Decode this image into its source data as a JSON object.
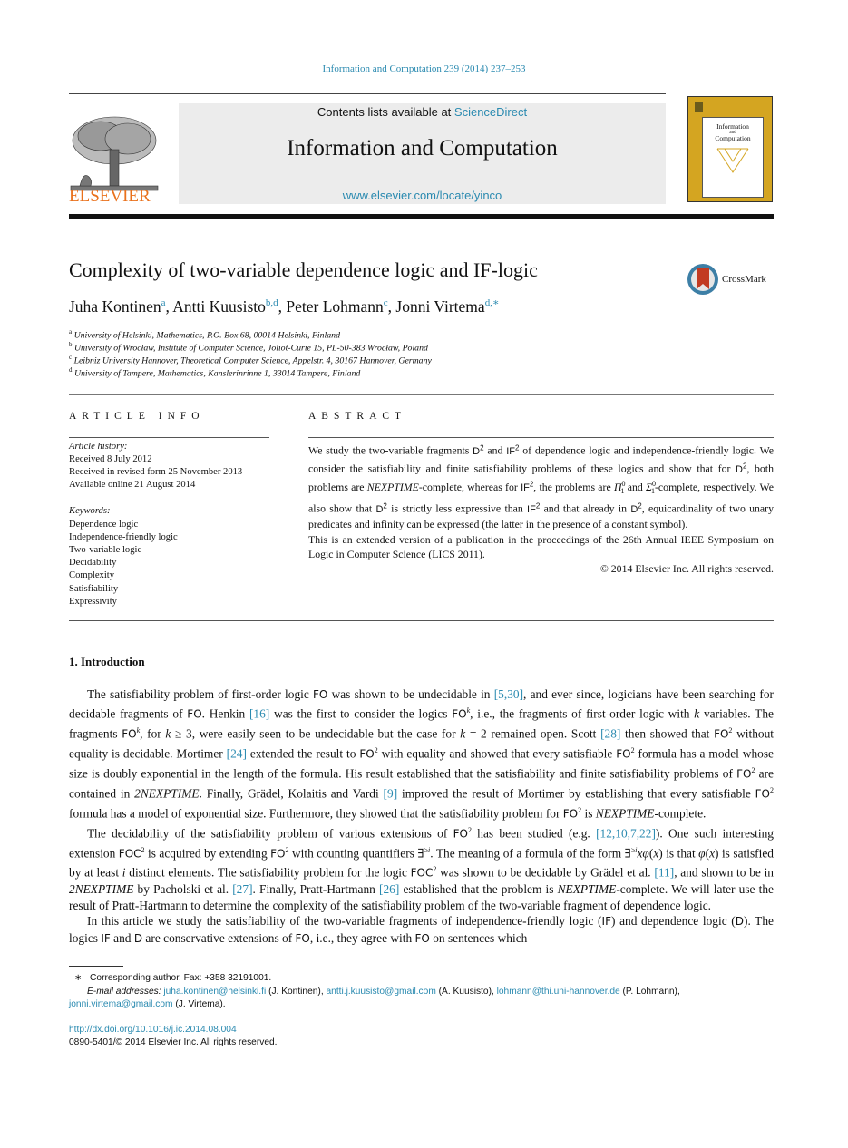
{
  "header": {
    "journal_ref": "Information and Computation 239 (2014) 237–253",
    "contents_prefix": "Contents lists available at ",
    "contents_link": "ScienceDirect",
    "journal_title": "Information and Computation",
    "journal_url": "www.elsevier.com/locate/yinco",
    "publisher": "ELSEVIER",
    "cover_title_1": "Information",
    "cover_title_2": "and",
    "cover_title_3": "Computation",
    "colors": {
      "link": "#2a8ab0",
      "elsevier_orange": "#e9711c",
      "cover_gold": "#d4a521"
    }
  },
  "article": {
    "title": "Complexity of two-variable dependence logic and IF-logic",
    "crossmark_label": "CrossMark",
    "authors": [
      {
        "name": "Juha Kontinen",
        "marks": "a"
      },
      {
        "name": "Antti Kuusisto",
        "marks": "b,d"
      },
      {
        "name": "Peter Lohmann",
        "marks": "c"
      },
      {
        "name": "Jonni Virtema",
        "marks": "d,∗"
      }
    ],
    "affiliations": [
      {
        "mark": "a",
        "text": "University of Helsinki, Mathematics, P.O. Box 68, 00014 Helsinki, Finland"
      },
      {
        "mark": "b",
        "text": "University of Wrocław, Institute of Computer Science, Joliot-Curie 15, PL-50-383 Wrocław, Poland"
      },
      {
        "mark": "c",
        "text": "Leibniz University Hannover, Theoretical Computer Science, Appelstr. 4, 30167 Hannover, Germany"
      },
      {
        "mark": "d",
        "text": "University of Tampere, Mathematics, Kanslerinrinne 1, 33014 Tampere, Finland"
      }
    ]
  },
  "article_info": {
    "heading": "ARTICLE INFO",
    "history_label": "Article history:",
    "history": [
      "Received 8 July 2012",
      "Received in revised form 25 November 2013",
      "Available online 21 August 2014"
    ],
    "keywords_label": "Keywords:",
    "keywords": [
      "Dependence logic",
      "Independence-friendly logic",
      "Two-variable logic",
      "Decidability",
      "Complexity",
      "Satisfiability",
      "Expressivity"
    ]
  },
  "abstract": {
    "heading": "ABSTRACT",
    "p1": {
      "a": "We study the two-variable fragments ",
      "b": " and ",
      "c": " of dependence logic and independence-friendly logic. We consider the satisfiability and finite satisfiability problems of these logics and show that for ",
      "d": ", both problems are ",
      "e": "NEXPTIME",
      "f": "-complete, whereas for ",
      "g": ", the problems are ",
      "h": " and ",
      "i": "-complete, respectively. We also show that ",
      "j": " is strictly less expressive than ",
      "k": " and that already in ",
      "l": ", equicardinality of two unary predicates and infinity can be expressed (the latter in the presence of a constant symbol)."
    },
    "p2": "This is an extended version of a publication in the proceedings of the 26th Annual IEEE Symposium on Logic in Computer Science (LICS 2011).",
    "copyright": "© 2014 Elsevier Inc. All rights reserved."
  },
  "intro": {
    "heading": "1.  Introduction",
    "refs": {
      "r5_30": "[5,30]",
      "r16": "[16]",
      "r28": "[28]",
      "r24": "[24]",
      "r9": "[9]",
      "r12": "[12,10,7,22]",
      "r11": "[11]",
      "r27": "[27]",
      "r26": "[26]"
    }
  },
  "footnotes": {
    "star": "∗",
    "corresponding": "Corresponding author. Fax: +358 32191001.",
    "email_label": "E-mail addresses:",
    "emails": [
      {
        "addr": "juha.kontinen@helsinki.fi",
        "who": " (J. Kontinen), "
      },
      {
        "addr": "antti.j.kuusisto@gmail.com",
        "who": " (A. Kuusisto), "
      },
      {
        "addr": "lohmann@thi.uni-hannover.de",
        "who": " (P. Lohmann),"
      },
      {
        "addr": "jonni.virtema@gmail.com",
        "who": " (J. Virtema)."
      }
    ],
    "doi": "http://dx.doi.org/10.1016/j.ic.2014.08.004",
    "issn": "0890-5401/© 2014 Elsevier Inc. All rights reserved."
  }
}
